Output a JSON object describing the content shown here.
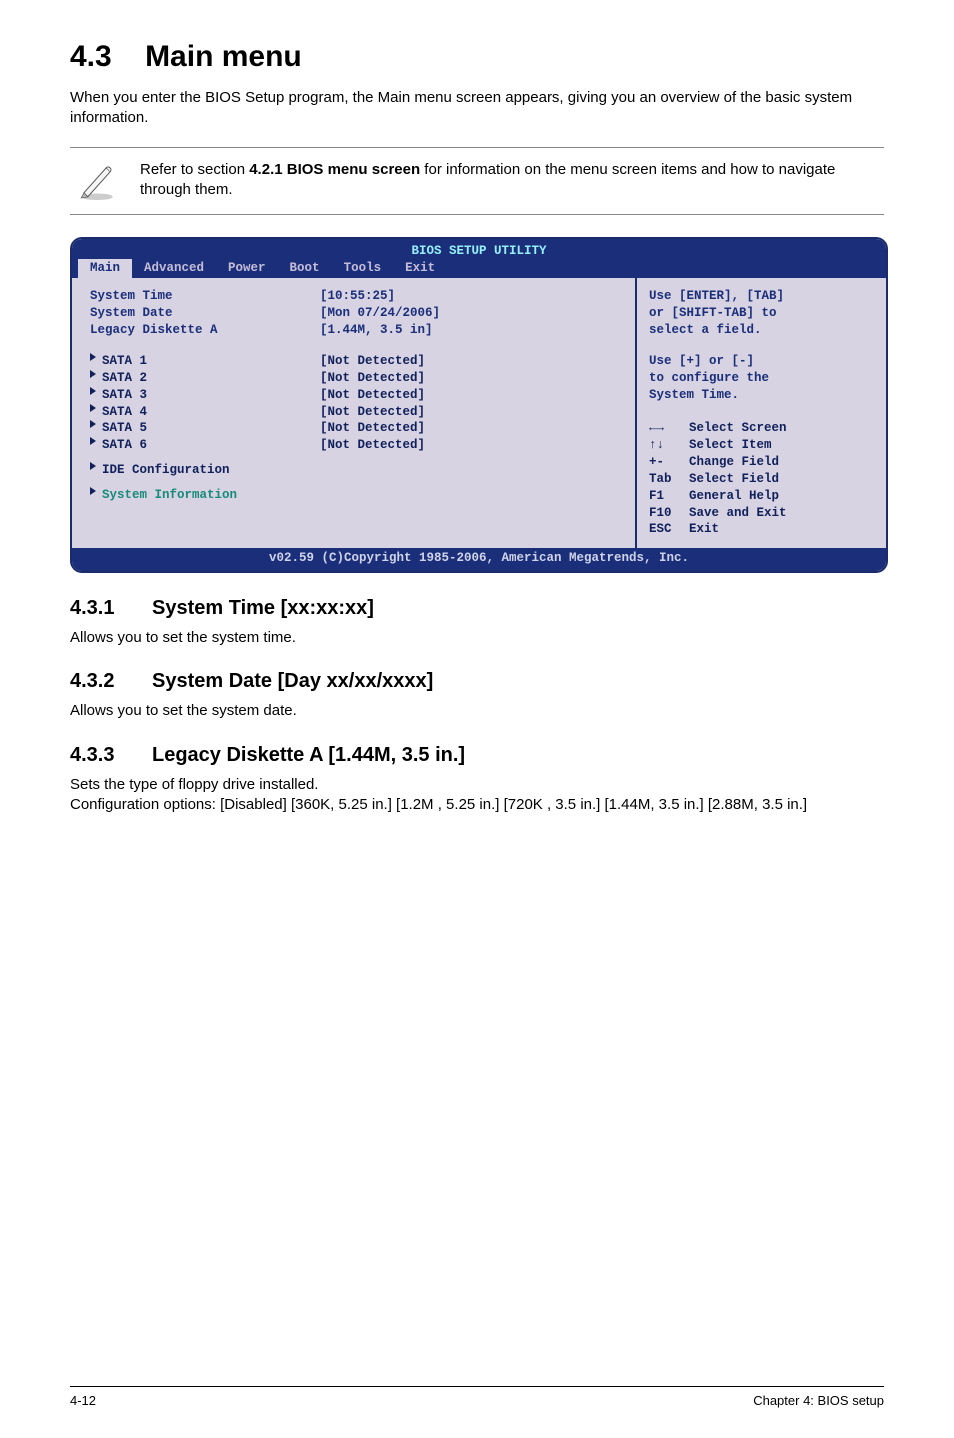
{
  "heading": {
    "number": "4.3",
    "title": "Main menu"
  },
  "intro": "When you enter the BIOS Setup program, the Main menu screen appears, giving you an overview of the basic system information.",
  "note": {
    "text_before_bold": "Refer to section ",
    "bold": "4.2.1  BIOS menu screen",
    "text_after_bold": " for information on the menu screen items and how to navigate through them."
  },
  "bios": {
    "bar_title": "BIOS SETUP UTILITY",
    "tabs": [
      "Main",
      "Advanced",
      "Power",
      "Boot",
      "Tools",
      "Exit"
    ],
    "active_tab": "Main",
    "top_rows": [
      {
        "label": "System Time",
        "value": "[10:55:25]"
      },
      {
        "label": "System Date",
        "value": "[Mon 07/24/2006]"
      },
      {
        "label": "Legacy Diskette A",
        "value": "[1.44M, 3.5 in]"
      }
    ],
    "sata_rows": [
      {
        "label": "SATA 1",
        "value": "[Not Detected]"
      },
      {
        "label": "SATA 2",
        "value": "[Not Detected]"
      },
      {
        "label": "SATA 3",
        "value": "[Not Detected]"
      },
      {
        "label": "SATA 4",
        "value": "[Not Detected]"
      },
      {
        "label": "SATA 5",
        "value": "[Not Detected]"
      },
      {
        "label": "SATA 6",
        "value": "[Not Detected]"
      }
    ],
    "menu_items": [
      "IDE Configuration",
      "System Information"
    ],
    "help_top": [
      "Use [ENTER], [TAB]",
      "or [SHIFT-TAB] to",
      "select a field.",
      "",
      "Use [+] or [-]",
      "to configure the",
      "System Time."
    ],
    "help_keys": [
      {
        "k": "←→",
        "d": "Select Screen"
      },
      {
        "k": "↑↓",
        "d": "Select Item"
      },
      {
        "k": "+-",
        "d": "Change Field"
      },
      {
        "k": "Tab",
        "d": "Select Field"
      },
      {
        "k": "F1",
        "d": "General Help"
      },
      {
        "k": "F10",
        "d": "Save and Exit"
      },
      {
        "k": "ESC",
        "d": "Exit"
      }
    ],
    "copyright": "v02.59 (C)Copyright 1985-2006, American Megatrends, Inc."
  },
  "subsections": [
    {
      "num": "4.3.1",
      "title": "System Time [xx:xx:xx]",
      "text": "Allows you to set the system time."
    },
    {
      "num": "4.3.2",
      "title": "System Date [Day xx/xx/xxxx]",
      "text": "Allows you to set the system date."
    },
    {
      "num": "4.3.3",
      "title": "Legacy Diskette A [1.44M, 3.5 in.]",
      "text": "Sets the type of floppy drive installed.\nConfiguration options: [Disabled] [360K, 5.25 in.] [1.2M , 5.25 in.] [720K , 3.5 in.] [1.44M, 3.5 in.] [2.88M, 3.5 in.]"
    }
  ],
  "footer": {
    "left": "4-12",
    "right": "Chapter 4: BIOS setup"
  }
}
